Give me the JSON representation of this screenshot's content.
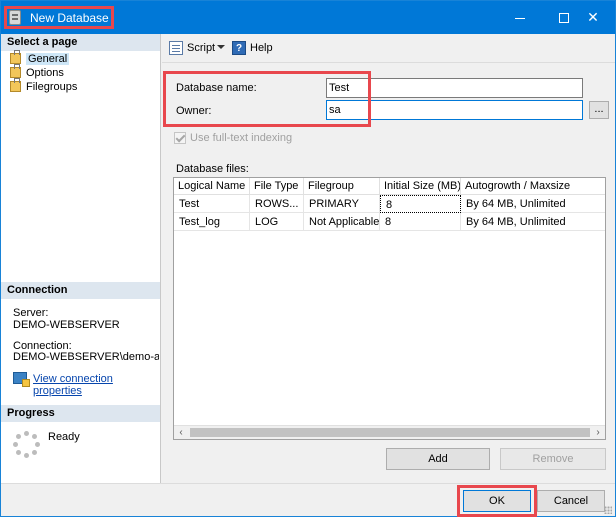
{
  "window": {
    "title": "New Database"
  },
  "sidebar": {
    "select_page_header": "Select a page",
    "pages": [
      {
        "label": "General",
        "selected": true
      },
      {
        "label": "Options",
        "selected": false
      },
      {
        "label": "Filegroups",
        "selected": false
      }
    ],
    "connection": {
      "header": "Connection",
      "server_label": "Server:",
      "server_value": "DEMO-WEBSERVER",
      "connection_label": "Connection:",
      "connection_value": "DEMO-WEBSERVER\\demo-admi",
      "link": "View connection properties"
    },
    "progress": {
      "header": "Progress",
      "status": "Ready"
    }
  },
  "toolbar": {
    "script_label": "Script",
    "help_label": "Help"
  },
  "form": {
    "database_name_label": "Database name:",
    "database_name_value": "Test",
    "owner_label": "Owner:",
    "owner_value": "sa",
    "browse_label": "...",
    "fulltext_label": "Use full-text indexing",
    "database_files_label": "Database files:"
  },
  "grid": {
    "columns": [
      "Logical Name",
      "File Type",
      "Filegroup",
      "Initial Size (MB)",
      "Autogrowth / Maxsize"
    ],
    "rows": [
      [
        "Test",
        "ROWS...",
        "PRIMARY",
        "8",
        "By 64 MB, Unlimited"
      ],
      [
        "Test_log",
        "LOG",
        "Not Applicable",
        "8",
        "By 64 MB, Unlimited"
      ]
    ]
  },
  "buttons": {
    "add": "Add",
    "remove": "Remove",
    "ok": "OK",
    "cancel": "Cancel"
  },
  "colors": {
    "titlebar": "#0078d7",
    "highlight": "#e8474d",
    "section_header": "#dde6ef",
    "link": "#0645ad"
  }
}
